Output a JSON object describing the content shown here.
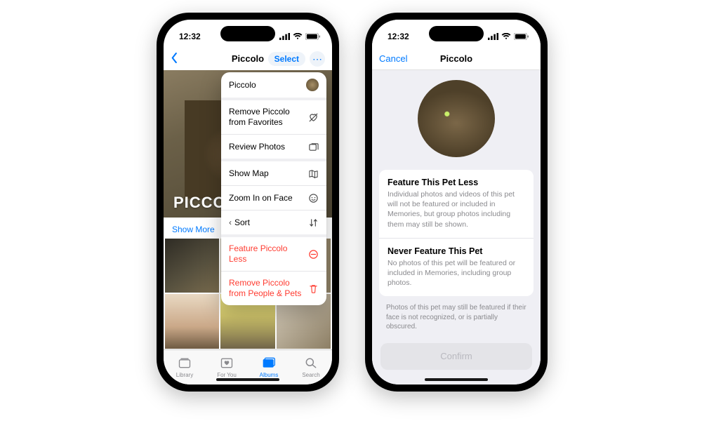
{
  "status": {
    "time": "12:32",
    "state_glyph": "▤"
  },
  "left": {
    "title": "Piccolo",
    "select_label": "Select",
    "hero_name": "PICCOLO",
    "show_more": "Show More",
    "menu": {
      "name": "Piccolo",
      "remove_fav": "Remove Piccolo from Favorites",
      "review": "Review Photos",
      "map": "Show Map",
      "zoom": "Zoom In on Face",
      "sort": "Sort",
      "feature_less": "Feature Piccolo Less",
      "remove_pp": "Remove Piccolo from People & Pets"
    },
    "tabs": {
      "library": "Library",
      "foryou": "For You",
      "albums": "Albums",
      "search": "Search"
    }
  },
  "right": {
    "cancel": "Cancel",
    "title": "Piccolo",
    "opt1_title": "Feature This Pet Less",
    "opt1_desc": "Individual photos and videos of this pet will not be featured or included in Memories, but group photos including them may still be shown.",
    "opt2_title": "Never Feature This Pet",
    "opt2_desc": "No photos of this pet will be featured or included in Memories, including group photos.",
    "footnote": "Photos of this pet may still be featured if their face is not recognized, or is partially obscured.",
    "confirm": "Confirm"
  }
}
